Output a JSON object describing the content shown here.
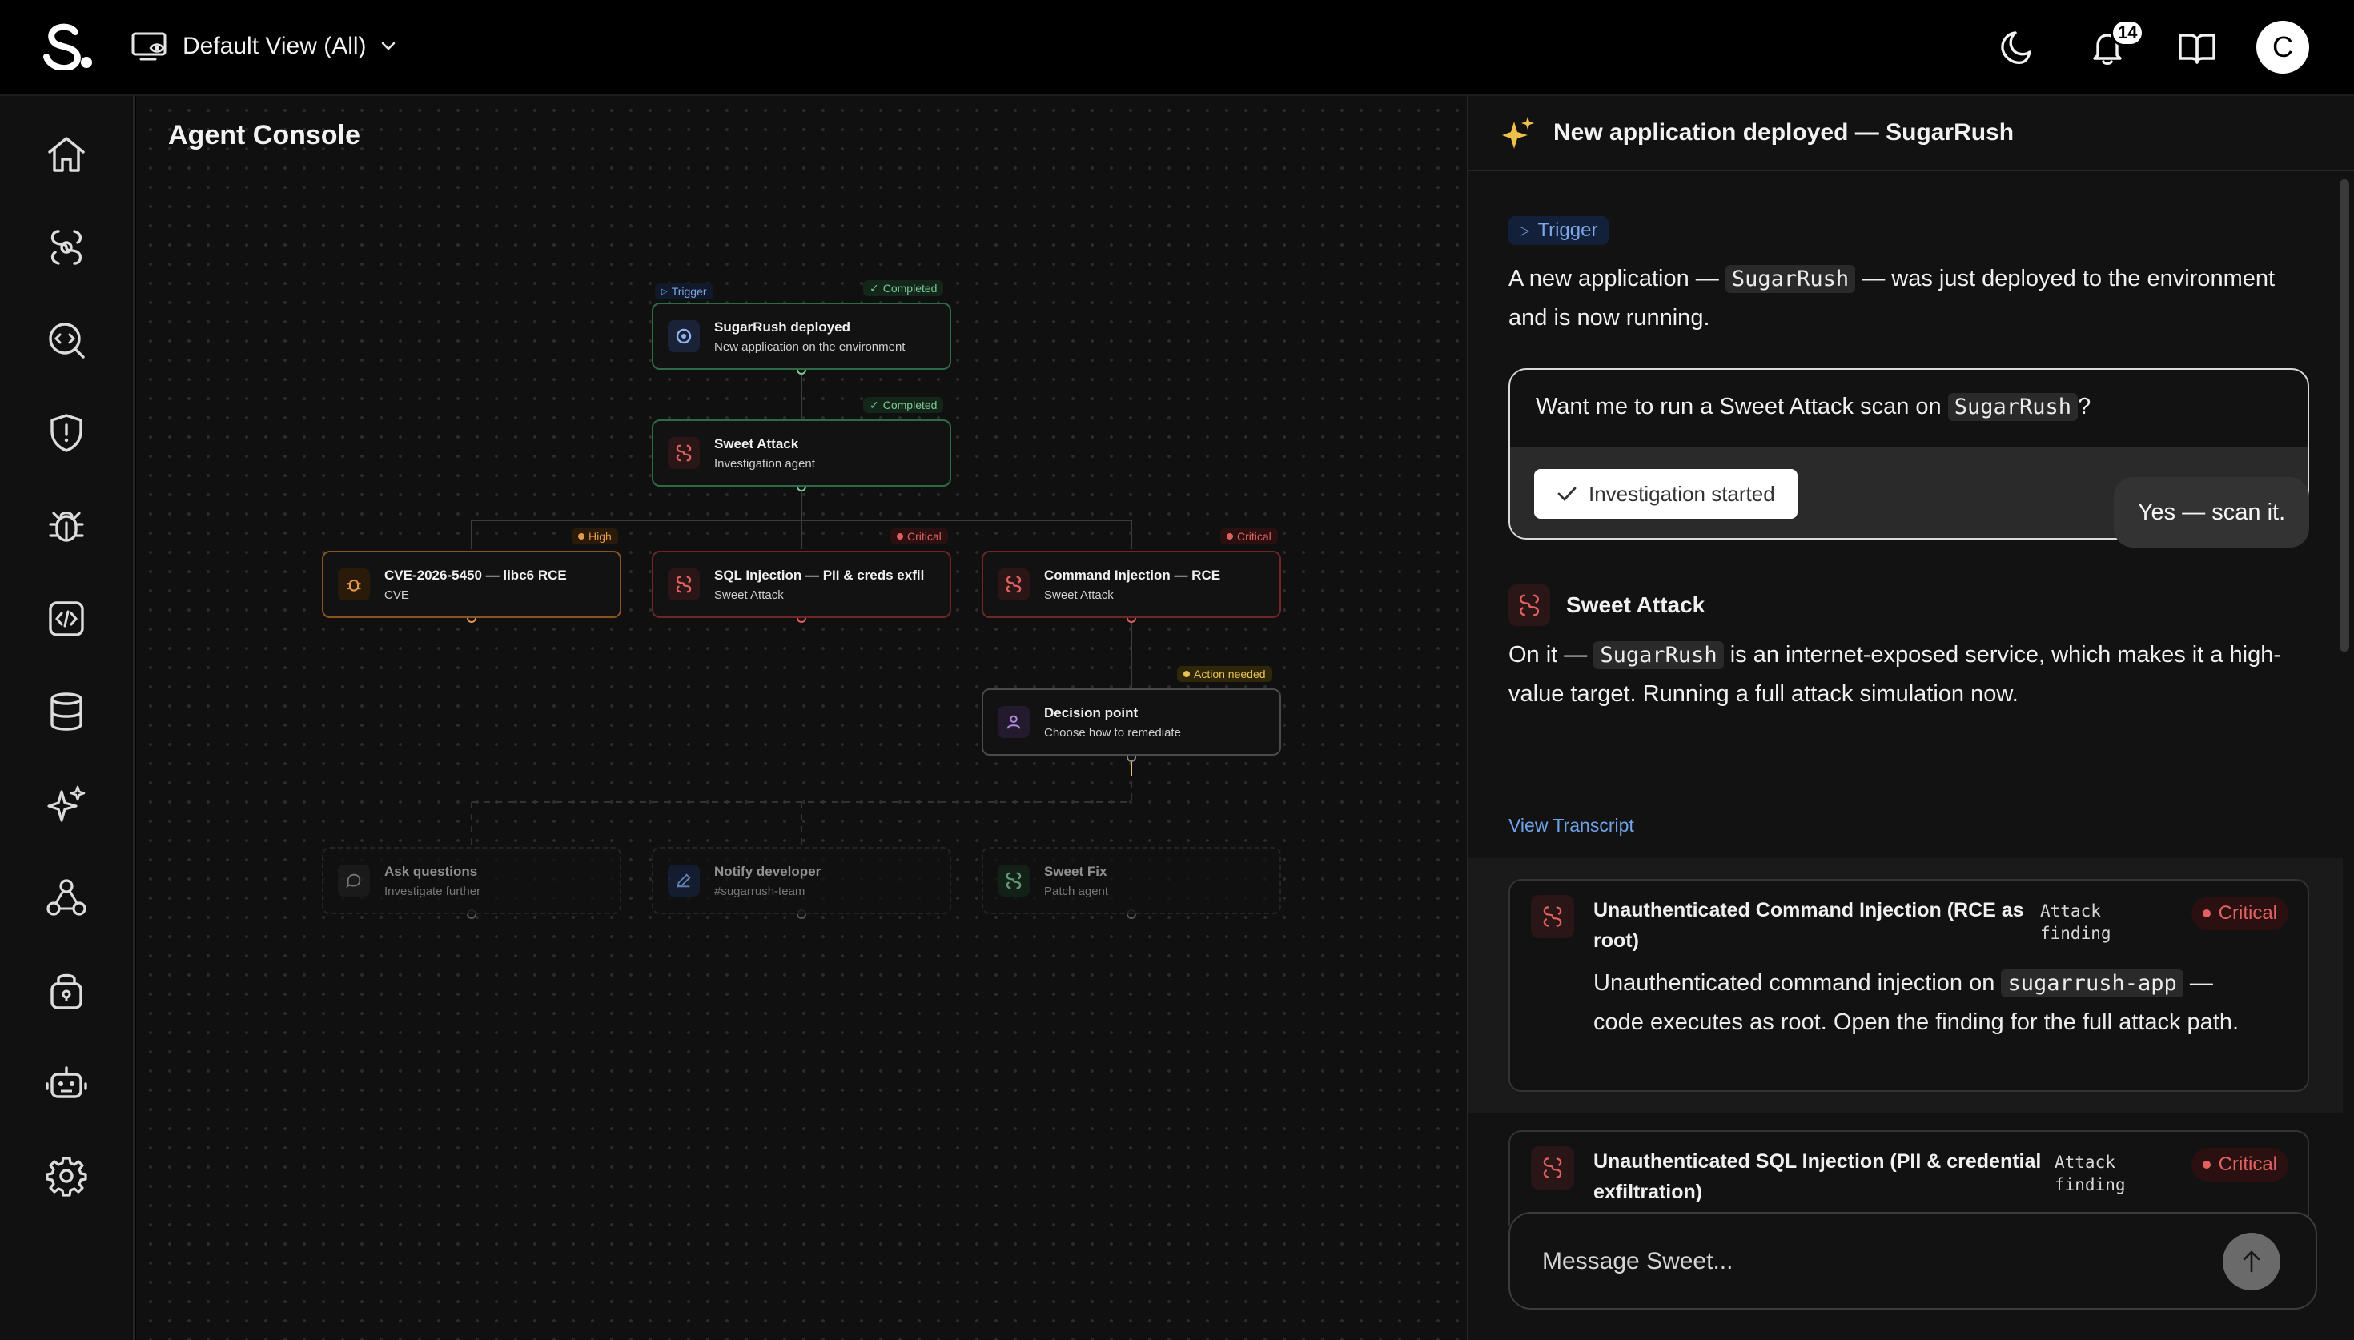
{
  "topbar": {
    "view_label": "Default View (All)",
    "notification_count": "14",
    "avatar_initial": "C"
  },
  "icons": {
    "logo": "sweet-logo",
    "view": "monitor-eye-icon",
    "theme": "moon-icon",
    "notifications": "bell-icon",
    "docs": "book-open-icon"
  },
  "sidebar": {
    "items": [
      {
        "name": "home",
        "icon": "home-icon"
      },
      {
        "name": "sweet-attack",
        "icon": "sweet-attack-icon"
      },
      {
        "name": "code-search",
        "icon": "code-search-icon"
      },
      {
        "name": "security",
        "icon": "shield-icon"
      },
      {
        "name": "bugs",
        "icon": "bug-icon"
      },
      {
        "name": "code",
        "icon": "code-file-icon"
      },
      {
        "name": "database",
        "icon": "database-icon"
      },
      {
        "name": "ai",
        "icon": "sparkles-icon"
      },
      {
        "name": "identities",
        "icon": "network-icon"
      },
      {
        "name": "secrets",
        "icon": "lock-bag-icon"
      },
      {
        "name": "agents",
        "icon": "robot-icon"
      },
      {
        "name": "settings",
        "icon": "gear-icon"
      }
    ]
  },
  "canvas": {
    "title": "Agent Console",
    "nodes": {
      "deployed": {
        "tag_left": "Trigger",
        "tag_right": "Completed",
        "title": "SugarRush deployed",
        "sub": "New application on the environment"
      },
      "sweet_attack": {
        "tag_right": "Completed",
        "title": "Sweet Attack",
        "sub": "Investigation agent"
      },
      "cve": {
        "tag_right": "High",
        "title": "CVE-2026-5450 — libc6 RCE",
        "sub": "CVE"
      },
      "sqli": {
        "tag_right": "Critical",
        "title": "SQL Injection — PII & creds exfil",
        "sub": "Sweet Attack"
      },
      "cmdi": {
        "tag_right": "Critical",
        "title": "Command Injection — RCE",
        "sub": "Sweet Attack"
      },
      "decision": {
        "tag_right": "Action needed",
        "title": "Decision point",
        "sub": "Choose how to remediate"
      },
      "ask": {
        "title": "Ask questions",
        "sub": "Investigate further"
      },
      "notify": {
        "title": "Notify developer",
        "sub": "#sugarrush-team"
      },
      "fix": {
        "title": "Sweet Fix",
        "sub": "Patch agent"
      }
    }
  },
  "panel": {
    "title": "New application deployed — SugarRush",
    "trigger_label": "Trigger",
    "intro": {
      "p1": "A new application — ",
      "code": "SugarRush",
      "p2": " — was just deployed to the environment and is now running."
    },
    "prompt": {
      "q1": "Want me to run a Sweet Attack scan on ",
      "code": "SugarRush",
      "q2": "?",
      "status": "Investigation started"
    },
    "user_reply": "Yes — scan it.",
    "agent": {
      "name": "Sweet Attack",
      "m1": "On it — ",
      "code": "SugarRush",
      "m2": " is an internet-exposed service, which makes it a high-value target. Running a full attack simulation now.",
      "link": "View Transcript"
    },
    "findings": [
      {
        "title": "Unauthenticated Command Injection (RCE as root)",
        "type": "Attack finding",
        "severity": "Critical",
        "d1": "Unauthenticated command injection on ",
        "code": "sugarrush-app",
        "d2": " — code executes as root. Open the finding for the full attack path."
      },
      {
        "title": "Unauthenticated SQL Injection (PII & credential exfiltration)",
        "type": "Attack finding",
        "severity": "Critical"
      }
    ],
    "composer_placeholder": "Message Sweet..."
  },
  "colors": {
    "accent_blue": "#6fa3e8",
    "critical": "#e26262",
    "high": "#e39a4c",
    "completed": "#7ec894",
    "action": "#e8c25a"
  }
}
